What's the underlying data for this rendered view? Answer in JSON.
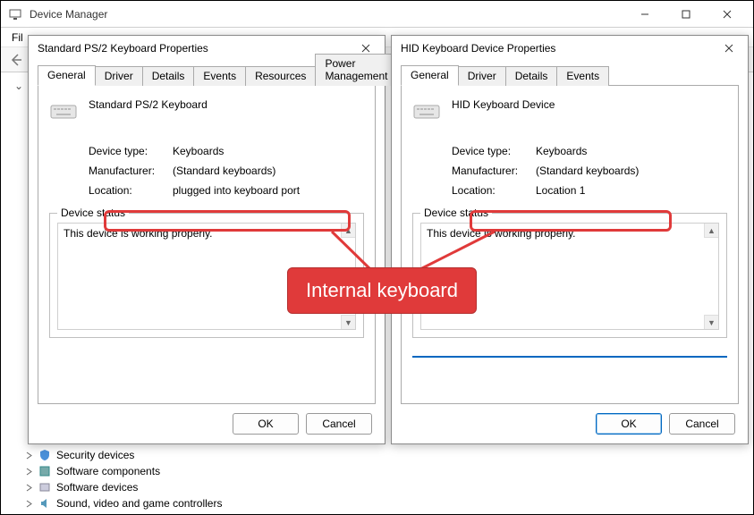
{
  "window": {
    "title": "Device Manager",
    "menu": {
      "file": "Fil"
    },
    "winbtns": {
      "min": "minimize",
      "max": "maximize",
      "close": "close"
    }
  },
  "tree": {
    "expander_top": "⌄",
    "items_bottom": [
      {
        "label": "Security devices"
      },
      {
        "label": "Software components"
      },
      {
        "label": "Software devices"
      },
      {
        "label": "Sound, video and game controllers"
      }
    ]
  },
  "dialogs": {
    "left": {
      "title": "Standard PS/2 Keyboard Properties",
      "tabs": [
        "General",
        "Driver",
        "Details",
        "Events",
        "Resources",
        "Power Management"
      ],
      "active_tab": "General",
      "device_name": "Standard PS/2 Keyboard",
      "rows": {
        "type_label": "Device type:",
        "type_value": "Keyboards",
        "mfr_label": "Manufacturer:",
        "mfr_value": "(Standard keyboards)",
        "loc_label": "Location:",
        "loc_value": "plugged into keyboard port"
      },
      "status_legend": "Device status",
      "status_text": "This device is working properly.",
      "ok": "OK",
      "cancel": "Cancel"
    },
    "right": {
      "title": "HID Keyboard Device Properties",
      "tabs": [
        "General",
        "Driver",
        "Details",
        "Events"
      ],
      "active_tab": "General",
      "device_name": "HID Keyboard Device",
      "rows": {
        "type_label": "Device type:",
        "type_value": "Keyboards",
        "mfr_label": "Manufacturer:",
        "mfr_value": "(Standard keyboards)",
        "loc_label": "Location:",
        "loc_value": "Location 1"
      },
      "status_legend": "Device status",
      "status_text": "This device is working properly.",
      "ok": "OK",
      "cancel": "Cancel"
    }
  },
  "annotation": {
    "label": "Internal keyboard"
  }
}
